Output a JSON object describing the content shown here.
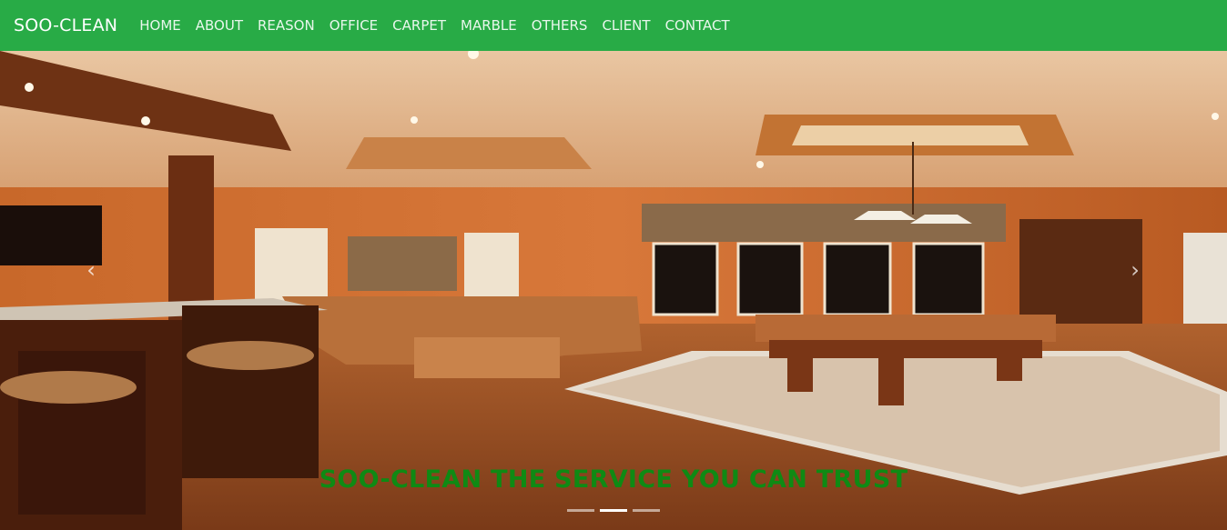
{
  "navbar": {
    "brand": "SOO-CLEAN",
    "items": [
      "HOME",
      "ABOUT",
      "REASON",
      "OFFICE",
      "CARPET",
      "MARBLE",
      "OTHERS",
      "CLIENT",
      "CONTACT"
    ],
    "bg_color": "#28ab46"
  },
  "carousel": {
    "caption": "SOO-CLEAN THE SERVICE YOU CAN TRUST",
    "caption_color": "#0f8a14",
    "prev_icon": "chevron-left-icon",
    "next_icon": "chevron-right-icon",
    "indicator_count": 3,
    "active_indicator": 1
  }
}
